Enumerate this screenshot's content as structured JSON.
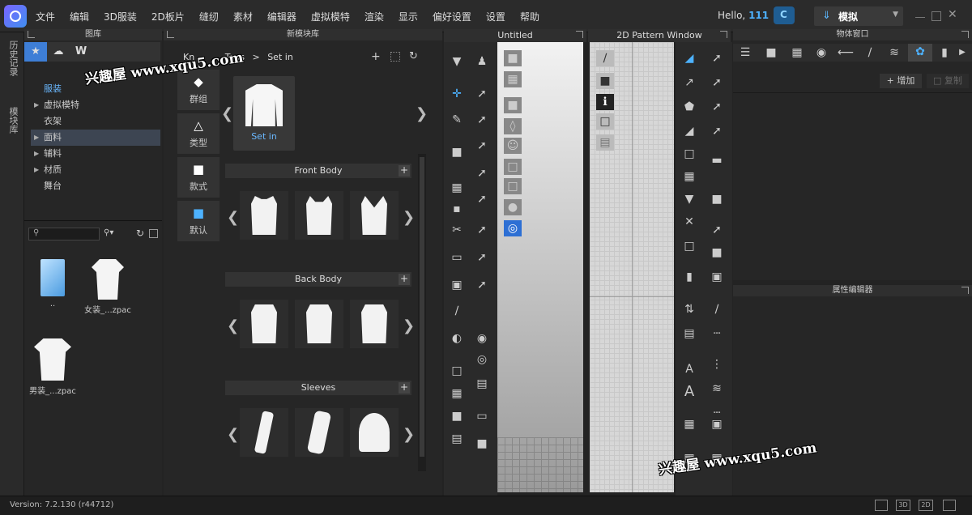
{
  "menubar": {
    "items": [
      "文件",
      "编辑",
      "3D服装",
      "2D板片",
      "缝纫",
      "素材",
      "编辑器",
      "虚拟模特",
      "渲染",
      "显示",
      "偏好设置",
      "设置",
      "帮助"
    ],
    "hello": "Hello,",
    "username": "111",
    "mode": "模拟"
  },
  "left_strip": {
    "history": "历史记录",
    "modules": "模块库"
  },
  "library": {
    "title": "图库",
    "tree": [
      {
        "label": "服装",
        "arrow": false,
        "selected": false
      },
      {
        "label": "虚拟模特",
        "arrow": true,
        "selected": false
      },
      {
        "label": "衣架",
        "arrow": false,
        "selected": false
      },
      {
        "label": "面料",
        "arrow": true,
        "selected": true
      },
      {
        "label": "辅料",
        "arrow": true,
        "selected": false
      },
      {
        "label": "材质",
        "arrow": true,
        "selected": false
      },
      {
        "label": "舞台",
        "arrow": false,
        "selected": false
      }
    ],
    "files": [
      {
        "name": ".."
      },
      {
        "name": "女装_...zpac"
      },
      {
        "name": "男装_...zpac"
      }
    ]
  },
  "modules": {
    "title": "新模块库",
    "breadcrumb": [
      "Kn",
      "Tops",
      ">",
      "Set in"
    ],
    "categories": [
      "群组",
      "类型",
      "款式",
      "默认"
    ],
    "selected_label": "Set in",
    "sections": [
      "Front Body",
      "Back Body",
      "Sleeves"
    ]
  },
  "viewport3d": {
    "title": "Untitled"
  },
  "pattern2d": {
    "title": "2D Pattern Window"
  },
  "object_window": {
    "title": "物体窗口",
    "add": "增加",
    "copy": "复制"
  },
  "property_editor": {
    "title": "属性编辑器"
  },
  "status": {
    "version": "Version: 7.2.130 (r44712)"
  },
  "watermark": "兴趣屋 www.xqu5.com"
}
